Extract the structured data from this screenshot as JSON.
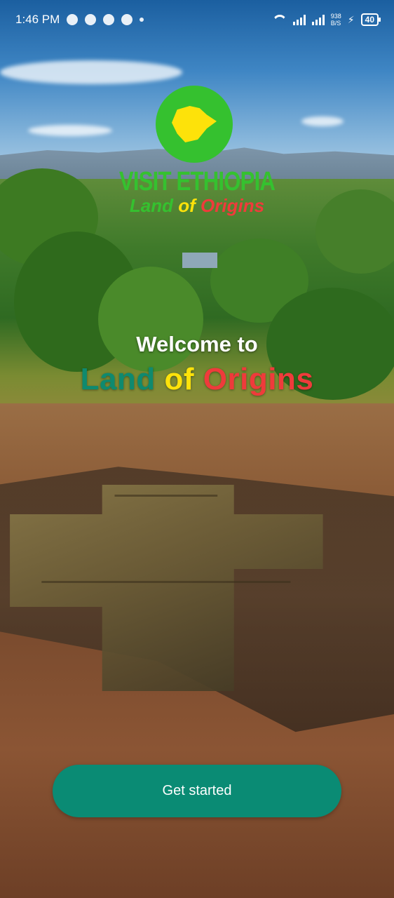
{
  "status_bar": {
    "time": "1:46 PM",
    "net_speed_top": "938",
    "net_speed_bottom": "B/S",
    "battery": "40",
    "icons": [
      "snapchat-icon",
      "messenger-icon",
      "bug-icon",
      "timer-icon",
      "dot-icon",
      "wifi-icon",
      "signal-icon",
      "signal-icon",
      "charging-icon",
      "battery-icon"
    ]
  },
  "logo": {
    "title": "VISIT ETHIOPIA",
    "subtitle_part1": "Land",
    "subtitle_part2": "of",
    "subtitle_part3": "Origins",
    "colors": {
      "green": "#35c12f",
      "yellow": "#fde20a",
      "red": "#ef3b3b"
    }
  },
  "welcome": {
    "line1": "Welcome to",
    "line2_part1": "Land",
    "line2_part2": "of",
    "line2_part3": "Origins",
    "colors": {
      "teal": "#0f8a6f",
      "yellow": "#fde20a",
      "red": "#ef3b3b"
    }
  },
  "cta": {
    "label": "Get started",
    "color": "#0a8b74"
  }
}
